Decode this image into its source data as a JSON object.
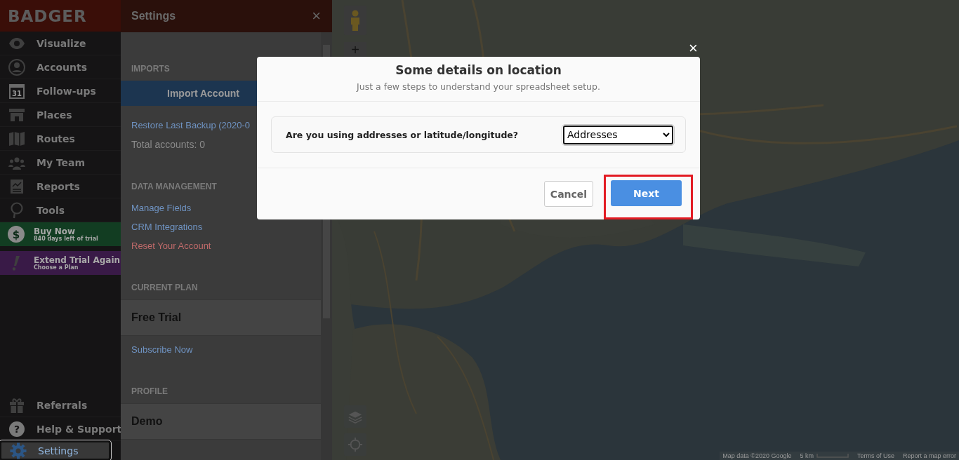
{
  "app": {
    "logo": "BADGER"
  },
  "nav": [
    {
      "label": "Visualize",
      "selected": false
    },
    {
      "label": "Accounts",
      "selected": false
    },
    {
      "label": "Follow-ups",
      "icon_text": "31",
      "selected": false
    },
    {
      "label": "Places",
      "selected": false
    },
    {
      "label": "Routes",
      "selected": false
    },
    {
      "label": "My Team",
      "selected": false
    },
    {
      "label": "Reports",
      "selected": false
    },
    {
      "label": "Tools",
      "selected": false
    }
  ],
  "promos": [
    {
      "kind": "buy",
      "title": "Buy Now",
      "subtitle": "840 days left of trial",
      "icon_text": "$"
    },
    {
      "kind": "extend",
      "title": "Extend Trial Again",
      "subtitle": "Choose a Plan"
    }
  ],
  "nav_bottom": [
    {
      "label": "Referrals",
      "selected": false
    },
    {
      "label": "Help & Support",
      "icon_text": "?",
      "selected": false
    },
    {
      "label": "Settings",
      "selected": true
    }
  ],
  "settings_panel": {
    "title": "Settings",
    "close": "×",
    "sections": [
      {
        "heading": "IMPORTS",
        "items": [
          {
            "kind": "button",
            "text": "Import Account"
          },
          {
            "kind": "link",
            "text": "Restore Last Backup (2020-0"
          },
          {
            "kind": "text",
            "text": "Total accounts: 0"
          }
        ]
      },
      {
        "heading": "DATA MANAGEMENT",
        "items": [
          {
            "kind": "link",
            "text": "Manage Fields"
          },
          {
            "kind": "link",
            "text": "CRM Integrations"
          },
          {
            "kind": "danger",
            "text": "Reset Your Account"
          }
        ]
      },
      {
        "heading": "CURRENT PLAN",
        "items": [
          {
            "kind": "row",
            "text": "Free Trial"
          },
          {
            "kind": "link",
            "text": "Subscribe Now"
          }
        ]
      },
      {
        "heading": "PROFILE",
        "items": [
          {
            "kind": "row",
            "text": "Demo"
          }
        ]
      }
    ]
  },
  "map": {
    "zoom_in": "+",
    "footer": [
      "Map data ©2020 Google",
      "5 km",
      "Terms of Use",
      "Report a map error"
    ]
  },
  "modal": {
    "close": "×",
    "title": "Some details on location",
    "subtitle": "Just a few steps to understand your spreadsheet setup.",
    "question": "Are you using addresses or latitude/longitude?",
    "select": {
      "value": "Addresses"
    },
    "buttons": [
      {
        "kind": "cancel",
        "label": "Cancel"
      },
      {
        "kind": "primary",
        "label": "Next",
        "highlighted": true
      }
    ]
  }
}
